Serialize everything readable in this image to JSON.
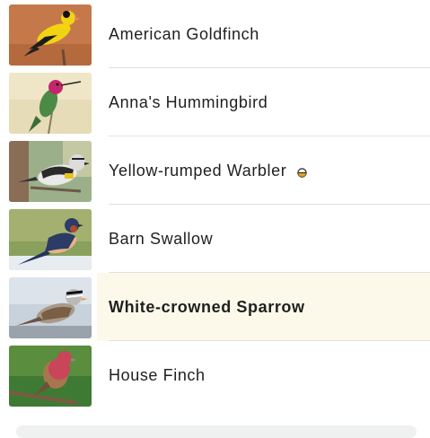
{
  "birds": [
    {
      "name": "American Goldfinch",
      "thumb_icon": "american-goldfinch-photo"
    },
    {
      "name": "Anna's Hummingbird",
      "thumb_icon": "annas-hummingbird-photo"
    },
    {
      "name": "Yellow-rumped Warbler",
      "thumb_icon": "yellow-rumped-warbler-photo",
      "badge_icon": "half-circle-icon"
    },
    {
      "name": "Barn Swallow",
      "thumb_icon": "barn-swallow-photo"
    },
    {
      "name": "White-crowned Sparrow",
      "thumb_icon": "white-crowned-sparrow-photo",
      "selected": true
    },
    {
      "name": "House Finch",
      "thumb_icon": "house-finch-photo"
    }
  ],
  "colors": {
    "highlight_background": "#fdf9ea",
    "divider": "#e0e0e0",
    "badge_fill": "#e3a31a",
    "text": "#1f1f1f"
  }
}
